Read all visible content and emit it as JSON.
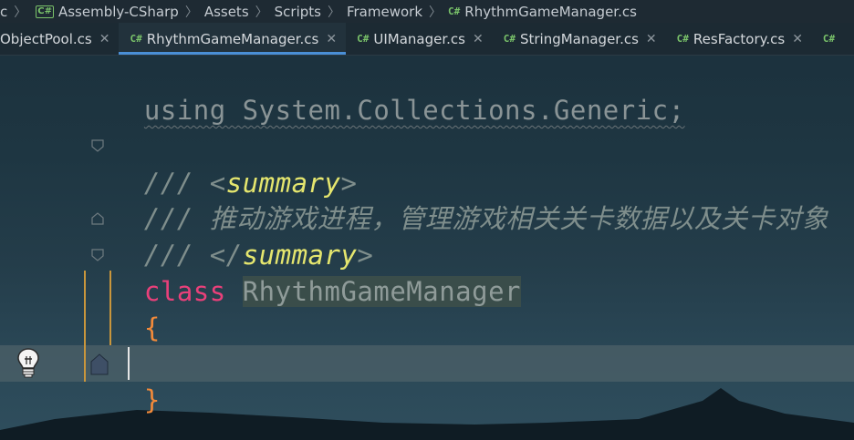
{
  "breadcrumb": {
    "items": [
      "c",
      "Assembly-CSharp",
      "Assets",
      "Scripts",
      "Framework",
      "RhythmGameManager.cs"
    ],
    "cs_badge": "C#"
  },
  "tabs": [
    {
      "label": "ObjectPool.cs",
      "active": false
    },
    {
      "label": "RhythmGameManager.cs",
      "active": true
    },
    {
      "label": "UIManager.cs",
      "active": false
    },
    {
      "label": "StringManager.cs",
      "active": false
    },
    {
      "label": "ResFactory.cs",
      "active": false
    },
    {
      "label": "",
      "active": false
    }
  ],
  "code": {
    "line_using": "using System.Collections.Generic;",
    "line_summary_open_prefix": "/// <",
    "line_summary_open_tag": "summary",
    "line_summary_open_suffix": ">",
    "line_comment": "/// 推动游戏进程，管理游戏相关关卡数据以及关卡对象",
    "line_summary_close_prefix": "/// </",
    "line_summary_close_tag": "summary",
    "line_summary_close_suffix": ">",
    "keyword_class": "class",
    "class_name": "RhythmGameManager",
    "open_brace": "{",
    "close_brace": "}"
  },
  "colors": {
    "keyword": "#e9407a",
    "doc_tag": "#e5e66e",
    "comment": "#7f8e8c",
    "brace": "#f28a3a",
    "active_tab_underline": "#4a8fd6",
    "csharp_badge": "#7ac36a"
  },
  "icons": [
    "csharp-file-icon",
    "chevron-right-icon",
    "close-icon",
    "fold-icon",
    "lightbulb-icon",
    "bookmark-icon"
  ]
}
